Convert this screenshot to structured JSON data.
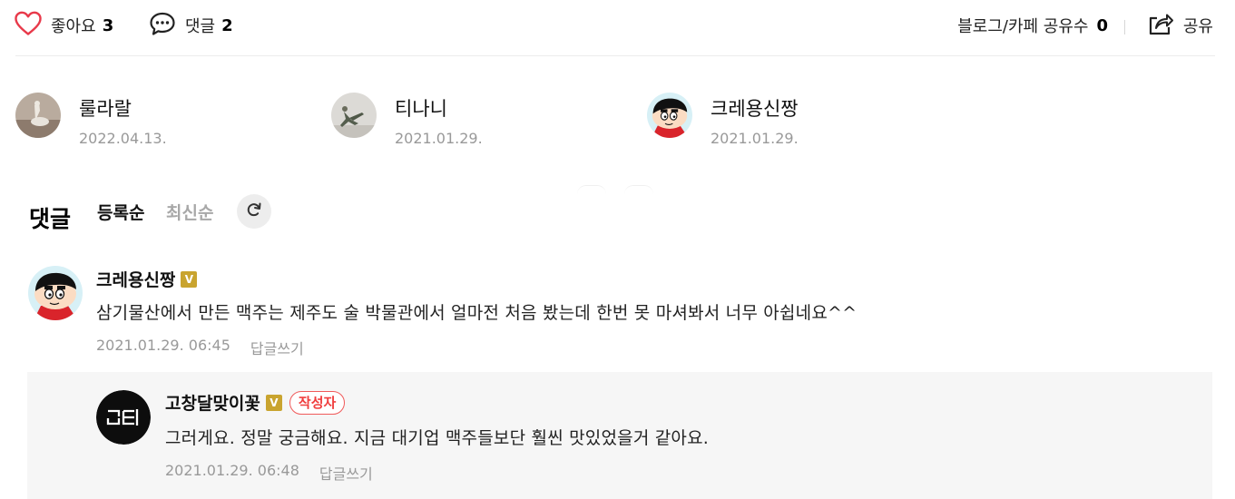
{
  "actions": {
    "like_label": "좋아요",
    "like_count": "3",
    "comment_label": "댓글",
    "comment_count": "2",
    "share_count_label": "블로그/카페 공유수",
    "share_count": "0",
    "share_label": "공유"
  },
  "likers": [
    {
      "name": "룰라랄",
      "date": "2022.04.13."
    },
    {
      "name": "티나니",
      "date": "2021.01.29."
    },
    {
      "name": "크레용신짱",
      "date": "2021.01.29."
    }
  ],
  "comments_section": {
    "title": "댓글",
    "sort_registered": "등록순",
    "sort_latest": "최신순"
  },
  "comments": [
    {
      "author": "크레용신짱",
      "verified_badge": "V",
      "text": "삼기물산에서 만든 맥주는 제주도 술 박물관에서 얼마전 처음 봤는데 한번 못 마셔봐서 너무 아쉽네요^^",
      "timestamp": "2021.01.29. 06:45",
      "reply_label": "답글쓰기"
    },
    {
      "author": "고창달맞이꽃",
      "verified_badge": "V",
      "writer_badge": "작성자",
      "text": "그러게요. 정말 궁금해요. 지금 대기업 맥주들보단 훨씬 맛있었을거 같아요.",
      "timestamp": "2021.01.29. 06:48",
      "reply_label": "답글쓰기"
    }
  ],
  "colors": {
    "heart": "#e8394a",
    "verified": "#c9a42f",
    "writer_badge": "#f03e3e",
    "muted_text": "#999999",
    "reply_bg": "#f6f6f6"
  }
}
